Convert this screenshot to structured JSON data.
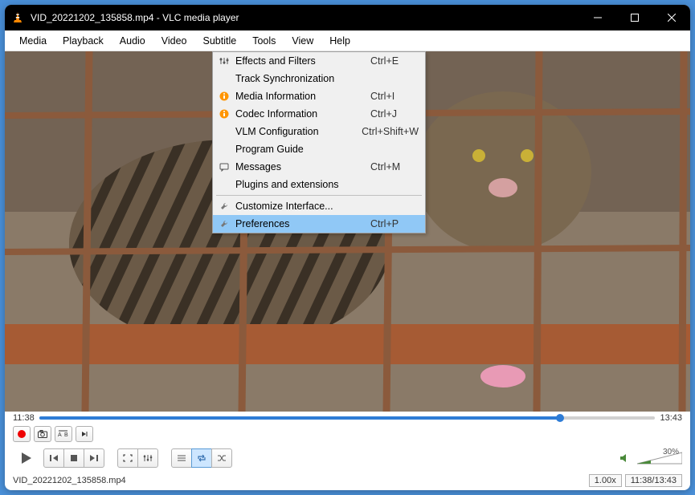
{
  "titlebar": {
    "title": "VID_20221202_135858.mp4 - VLC media player"
  },
  "menubar": {
    "items": [
      "Media",
      "Playback",
      "Audio",
      "Video",
      "Subtitle",
      "Tools",
      "View",
      "Help"
    ]
  },
  "tools_menu": {
    "items": [
      {
        "icon": "sliders",
        "label": "Effects and Filters",
        "shortcut": "Ctrl+E"
      },
      {
        "icon": "",
        "label": "Track Synchronization",
        "shortcut": ""
      },
      {
        "icon": "info",
        "label": "Media Information",
        "shortcut": "Ctrl+I"
      },
      {
        "icon": "info",
        "label": "Codec Information",
        "shortcut": "Ctrl+J"
      },
      {
        "icon": "",
        "label": "VLM Configuration",
        "shortcut": "Ctrl+Shift+W"
      },
      {
        "icon": "",
        "label": "Program Guide",
        "shortcut": ""
      },
      {
        "icon": "message",
        "label": "Messages",
        "shortcut": "Ctrl+M"
      },
      {
        "icon": "",
        "label": "Plugins and extensions",
        "shortcut": ""
      }
    ],
    "separator": true,
    "items2": [
      {
        "icon": "wrench",
        "label": "Customize Interface...",
        "shortcut": ""
      },
      {
        "icon": "wrench",
        "label": "Preferences",
        "shortcut": "Ctrl+P",
        "highlighted": true
      }
    ]
  },
  "time": {
    "current": "11:38",
    "total": "13:43"
  },
  "volume": {
    "percent": "30%"
  },
  "status": {
    "filename": "VID_20221202_135858.mp4",
    "speed": "1.00x",
    "time": "11:38/13:43"
  }
}
